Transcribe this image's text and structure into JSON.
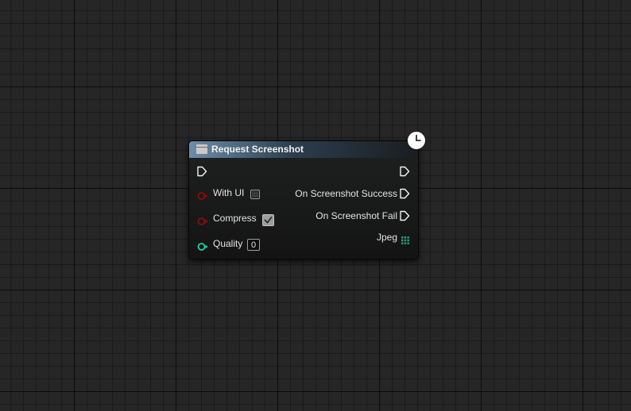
{
  "node": {
    "title": "Request Screenshot",
    "header_color": "#6c8ea8",
    "inputs": [
      {
        "label": "With UI",
        "type": "bool",
        "value": false,
        "pin_color": "#8a0d0d"
      },
      {
        "label": "Compress",
        "type": "bool",
        "value": true,
        "pin_color": "#8a0d0d"
      },
      {
        "label": "Quality",
        "type": "int",
        "value": "0",
        "pin_color": "#1fd1a8"
      }
    ],
    "outputs": [
      {
        "label": "On Screenshot Success",
        "type": "exec"
      },
      {
        "label": "On Screenshot Fail",
        "type": "exec"
      },
      {
        "label": "Jpeg",
        "type": "array",
        "pin_color": "#1e9e82"
      }
    ],
    "icons": {
      "node_icon": "function-icon",
      "latent_icon": "clock-icon",
      "exec_in": "exec-in-pin-icon",
      "exec_out": "exec-out-pin-icon"
    }
  }
}
